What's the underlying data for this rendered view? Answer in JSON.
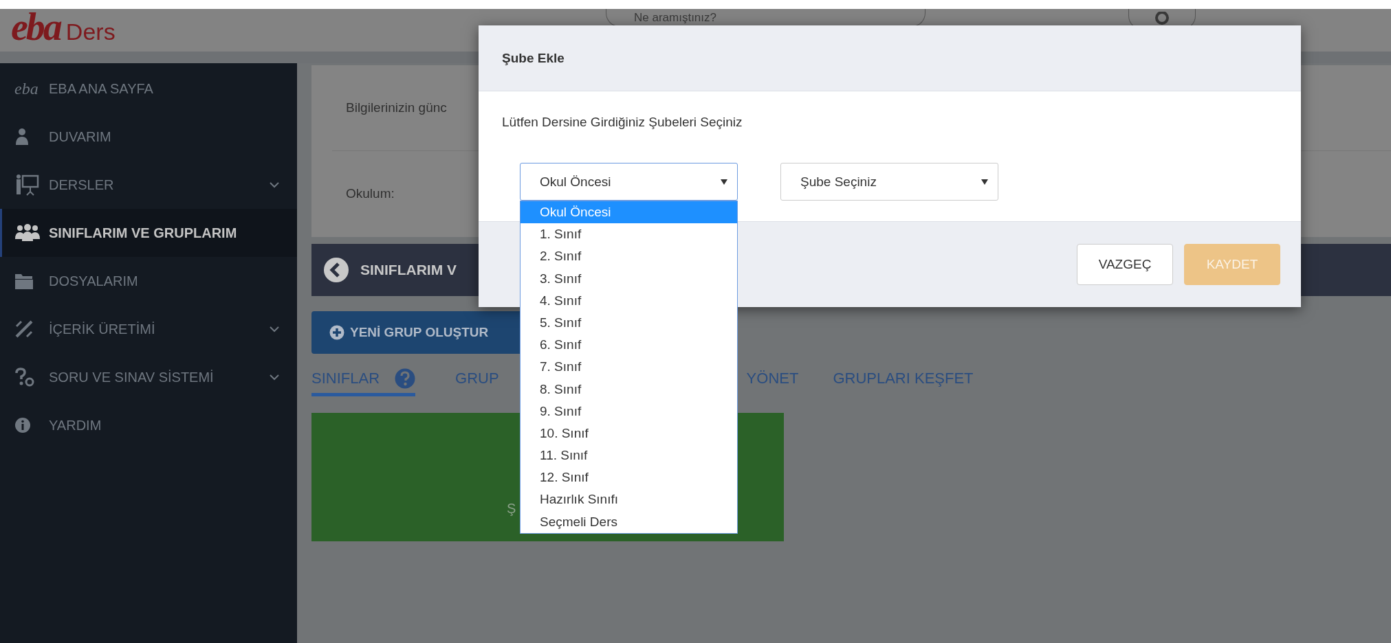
{
  "header": {
    "logo_mark": "eba",
    "logo_text": "Ders",
    "search": {
      "placeholder": "Ne aramıştınız?"
    }
  },
  "sidebar": {
    "items": [
      {
        "label": "EBA ANA SAYFA",
        "icon_text": "eba",
        "selected": false,
        "has_submenu": false
      },
      {
        "label": "DUVARIM",
        "selected": false,
        "has_submenu": false
      },
      {
        "label": "DERSLER",
        "selected": false,
        "has_submenu": true
      },
      {
        "label": "SINIFLARIM VE GRUPLARIM",
        "selected": true,
        "has_submenu": false
      },
      {
        "label": "DOSYALARIM",
        "selected": false,
        "has_submenu": false
      },
      {
        "label": "İÇERİK ÜRETİMİ",
        "selected": false,
        "has_submenu": true
      },
      {
        "label": "SORU VE SINAV SİSTEMİ",
        "selected": false,
        "has_submenu": true
      },
      {
        "label": "YARDIM",
        "selected": false,
        "has_submenu": false
      }
    ]
  },
  "info_panel": {
    "notice": "Bilgilerinizin günc",
    "school_label": "Okulum:"
  },
  "title_bar": {
    "title": "SINIFLARIM V"
  },
  "new_group_button": "YENİ GRUP OLUŞTUR",
  "tabs": [
    {
      "label": "SINIFLAR",
      "selected": true,
      "help": true
    },
    {
      "label": "GRUP",
      "selected": false,
      "help": false
    },
    {
      "label": "YÖNET",
      "selected": false,
      "help": false
    },
    {
      "label": "GRUPLARI KEŞFET",
      "selected": false,
      "help": false
    }
  ],
  "class_card": {
    "text": "Ş"
  },
  "modal": {
    "title": "Şube Ekle",
    "instruction": "Lütfen Dersine Girdiğiniz Şubeleri Seçiniz",
    "level_select": {
      "value": "Okul Öncesi",
      "open": true,
      "options": [
        {
          "label": "Okul Öncesi",
          "selected": true
        },
        {
          "label": "1. Sınıf",
          "selected": false
        },
        {
          "label": "2. Sınıf",
          "selected": false
        },
        {
          "label": "3. Sınıf",
          "selected": false
        },
        {
          "label": "4. Sınıf",
          "selected": false
        },
        {
          "label": "5. Sınıf",
          "selected": false
        },
        {
          "label": "6. Sınıf",
          "selected": false
        },
        {
          "label": "7. Sınıf",
          "selected": false
        },
        {
          "label": "8. Sınıf",
          "selected": false
        },
        {
          "label": "9. Sınıf",
          "selected": false
        },
        {
          "label": "10. Sınıf",
          "selected": false
        },
        {
          "label": "11. Sınıf",
          "selected": false
        },
        {
          "label": "12. Sınıf",
          "selected": false
        },
        {
          "label": "Hazırlık Sınıfı",
          "selected": false
        },
        {
          "label": "Seçmeli Ders",
          "selected": false
        }
      ]
    },
    "branch_select": {
      "value": "Şube Seçiniz",
      "open": false
    },
    "buttons": [
      {
        "label": "VAZGEÇ",
        "kind": "cancel",
        "disabled": false
      },
      {
        "label": "KAYDET",
        "kind": "primary",
        "disabled": true
      }
    ]
  }
}
